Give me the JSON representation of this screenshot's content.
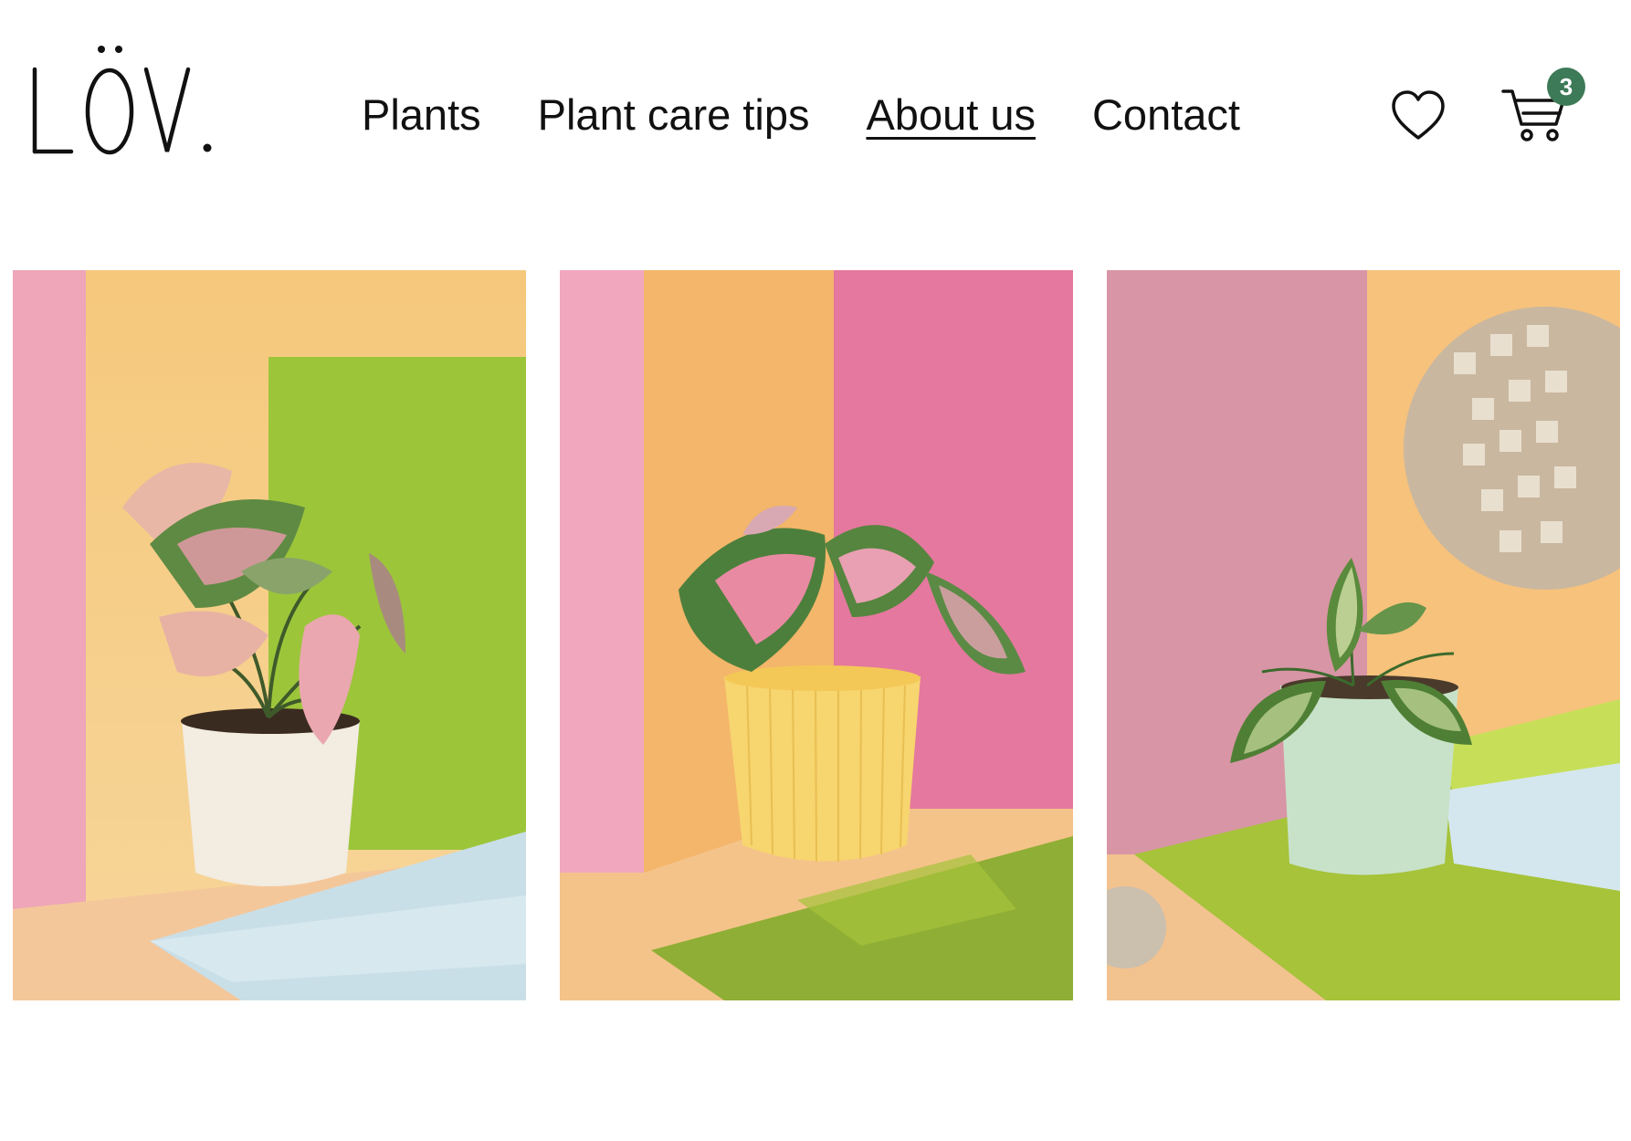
{
  "brand": {
    "logo_text": "LÖV."
  },
  "nav": {
    "items": [
      {
        "label": "Plants",
        "active": false
      },
      {
        "label": "Plant care tips",
        "active": false
      },
      {
        "label": "About us",
        "active": true
      },
      {
        "label": "Contact",
        "active": false
      }
    ]
  },
  "header_actions": {
    "wishlist_icon": "heart-icon",
    "cart_icon": "cart-icon",
    "cart_count": "3",
    "badge_color": "#3d7a58"
  },
  "gallery": {
    "photos": [
      {
        "subject": "caladium-white-pot-photo"
      },
      {
        "subject": "caladium-yellow-pot-photo"
      },
      {
        "subject": "peperomia-mint-pot-photo"
      }
    ]
  }
}
